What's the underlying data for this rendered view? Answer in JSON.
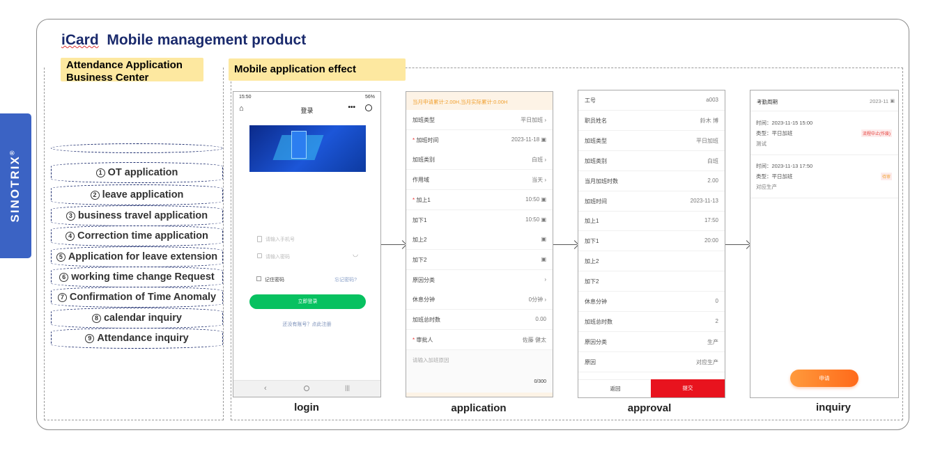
{
  "title": {
    "brand_part": "iCard",
    "rest": "Mobile management product"
  },
  "brand": "SINOTRIX",
  "brand_mark": "®",
  "left_tag": "Attendance Application Business Center",
  "right_tag": "Mobile application effect",
  "menu": [
    {
      "num": "1",
      "label": "OT application"
    },
    {
      "num": "2",
      "label": "leave application"
    },
    {
      "num": "3",
      "label": "business travel application"
    },
    {
      "num": "4",
      "label": "Correction time application"
    },
    {
      "num": "5",
      "label": "Application for leave extension"
    },
    {
      "num": "6",
      "label": "working time change Request"
    },
    {
      "num": "7",
      "label": "Confirmation of Time Anomaly"
    },
    {
      "num": "8",
      "label": "calendar inquiry"
    },
    {
      "num": "9",
      "label": "Attendance inquiry"
    }
  ],
  "captions": {
    "login": "login",
    "application": "application",
    "approval": "approval",
    "inquiry": "inquiry"
  },
  "login": {
    "status_time": "15:50",
    "status_right": "56%",
    "title": "登录",
    "phone_placeholder": "请输入手机号",
    "password_placeholder": "请输入密码",
    "remember": "记住密码",
    "forgot": "忘记密码?",
    "login_btn": "立即登录",
    "register": "还没有账号？点此注册"
  },
  "application": {
    "banner": "当月申请累计:2.00H,当月实际累计:0.00H",
    "rows": [
      {
        "label": "加班类型",
        "value": "平日加班",
        "req": false,
        "icon": "›"
      },
      {
        "label": "加班时间",
        "value": "2023-11-18",
        "req": true,
        "icon": "▣"
      },
      {
        "label": "加班类别",
        "value": "白班",
        "req": false,
        "icon": "›"
      },
      {
        "label": "作用域",
        "value": "当天",
        "req": false,
        "icon": "›"
      },
      {
        "label": "加上1",
        "value": "10:50",
        "req": true,
        "icon": "▣"
      },
      {
        "label": "加下1",
        "value": "10:50",
        "req": false,
        "icon": "▣"
      },
      {
        "label": "加上2",
        "value": "",
        "req": false,
        "icon": "▣"
      },
      {
        "label": "加下2",
        "value": "",
        "req": false,
        "icon": "▣"
      },
      {
        "label": "原因分类",
        "value": "",
        "req": false,
        "icon": "›"
      },
      {
        "label": "休息分钟",
        "value": "0分钟",
        "req": false,
        "icon": "›"
      },
      {
        "label": "加班总时数",
        "value": "0.00",
        "req": false,
        "icon": ""
      },
      {
        "label": "审批人",
        "value": "佐藤  健太",
        "req": true,
        "icon": ""
      }
    ],
    "reason_placeholder": "请输入加班原因",
    "counter": "0/300"
  },
  "approval": {
    "rows": [
      {
        "label": "工号",
        "value": "a003"
      },
      {
        "label": "职员姓名",
        "value": "鈴木  博"
      },
      {
        "label": "加班类型",
        "value": "平日加班"
      },
      {
        "label": "加班类别",
        "value": "白班"
      },
      {
        "label": "当月加班时数",
        "value": "2.00"
      },
      {
        "label": "加班时间",
        "value": "2023-11-13"
      },
      {
        "label": "加上1",
        "value": "17:50"
      },
      {
        "label": "加下1",
        "value": "20:00"
      },
      {
        "label": "加上2",
        "value": ""
      },
      {
        "label": "加下2",
        "value": ""
      },
      {
        "label": "休息分钟",
        "value": "0"
      },
      {
        "label": "加班总时数",
        "value": "2"
      },
      {
        "label": "原因分类",
        "value": "生产"
      },
      {
        "label": "原因",
        "value": "对应生产"
      }
    ],
    "back": "返回",
    "submit": "提交"
  },
  "inquiry": {
    "period_label": "考勤周期",
    "period_value": "2023-11",
    "records": [
      {
        "time": "时间：2023-11-15 15:00",
        "type": "类型：平日加班",
        "note": "测试",
        "status": "流程中止(作废)",
        "status_color": "#e53935"
      },
      {
        "time": "时间：2023-11-13 17:50",
        "type": "类型：平日加班",
        "note": "对应生产",
        "status": "待审",
        "status_color": "#f0a030"
      }
    ],
    "apply_btn": "申请"
  }
}
